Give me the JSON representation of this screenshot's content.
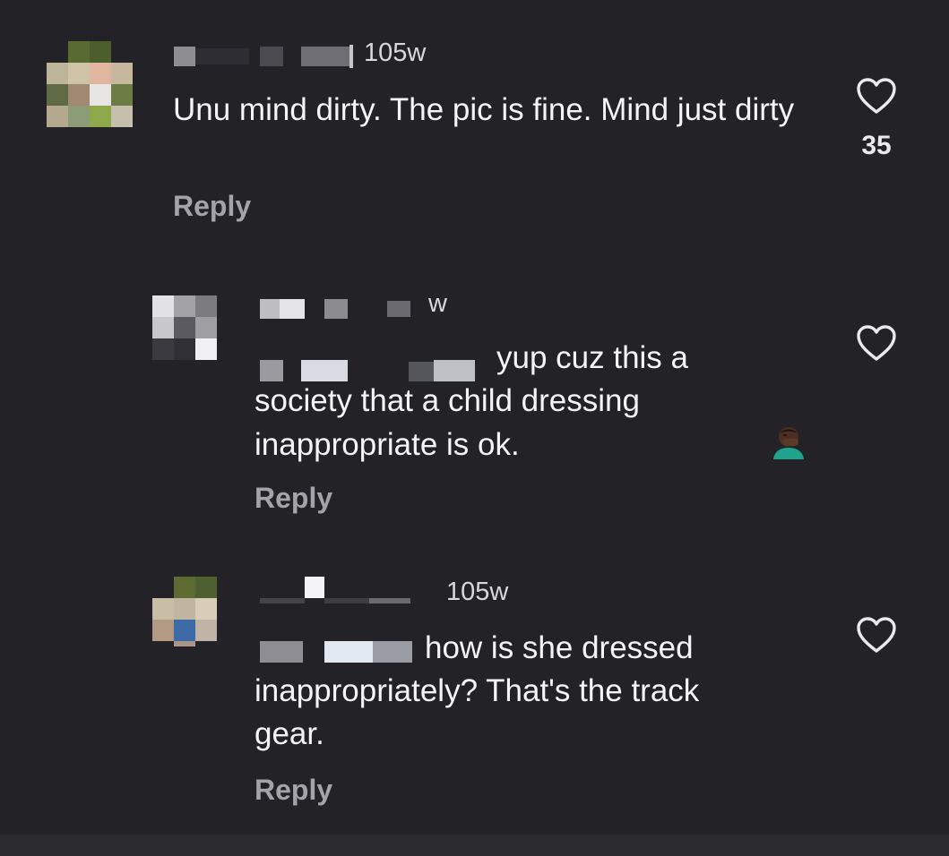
{
  "comments": [
    {
      "time": "105w",
      "text": "Unu mind dirty. The pic is fine. Mind just dirty",
      "reply": "Reply",
      "likes": "35",
      "like_icon": "heart-icon"
    },
    {
      "time": "w",
      "text": "yup cuz this a society that a child dressing inappropriate is ok.",
      "emoji": "facepalm-emoji",
      "reply": "Reply",
      "like_icon": "heart-icon"
    },
    {
      "time": "105w",
      "text": "how is she dressed inappropriately? That's the track gear.",
      "reply": "Reply",
      "like_icon": "heart-icon"
    }
  ],
  "colors": {
    "background": "#222227",
    "text": "#f5f5f7",
    "muted": "#a3a3a9"
  }
}
